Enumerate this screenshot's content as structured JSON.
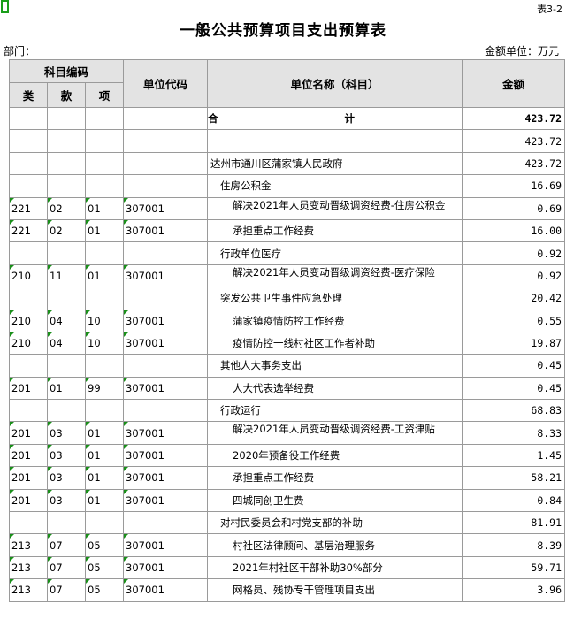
{
  "header": {
    "table_code": "表3-2",
    "title": "一般公共预算项目支出预算表",
    "dept_label": "部门：",
    "unit_label": "金额单位：万元"
  },
  "columns": {
    "subject_code": "科目编码",
    "lei": "类",
    "kuan": "款",
    "xiang": "项",
    "unit_code": "单位代码",
    "unit_name": "单位名称（科目）",
    "amount": "金额"
  },
  "rows": [
    {
      "lei": "",
      "kuan": "",
      "xiang": "",
      "code": "",
      "name": "合　　计",
      "amount": "423.72",
      "level": "total",
      "tri": false
    },
    {
      "lei": "",
      "kuan": "",
      "xiang": "",
      "code": "",
      "name": "",
      "amount": "423.72",
      "level": 0,
      "tri": false
    },
    {
      "lei": "",
      "kuan": "",
      "xiang": "",
      "code": "",
      "name": "达州市通川区蒲家镇人民政府",
      "amount": "423.72",
      "level": 0,
      "tri": false
    },
    {
      "lei": "",
      "kuan": "",
      "xiang": "",
      "code": "",
      "name": "住房公积金",
      "amount": "16.69",
      "level": 1,
      "tri": false
    },
    {
      "lei": "221",
      "kuan": "02",
      "xiang": "01",
      "code": "307001",
      "name": "解决2021年人员变动晋级调资经费-住房公积金",
      "amount": "0.69",
      "level": 2,
      "tri": true
    },
    {
      "lei": "221",
      "kuan": "02",
      "xiang": "01",
      "code": "307001",
      "name": "承担重点工作经费",
      "amount": "16.00",
      "level": 2,
      "tri": true
    },
    {
      "lei": "",
      "kuan": "",
      "xiang": "",
      "code": "",
      "name": "行政单位医疗",
      "amount": "0.92",
      "level": 1,
      "tri": false
    },
    {
      "lei": "210",
      "kuan": "11",
      "xiang": "01",
      "code": "307001",
      "name": "解决2021年人员变动晋级调资经费-医疗保险",
      "amount": "0.92",
      "level": 2,
      "tri": true
    },
    {
      "lei": "",
      "kuan": "",
      "xiang": "",
      "code": "",
      "name": "突发公共卫生事件应急处理",
      "amount": "20.42",
      "level": 1,
      "tri": false
    },
    {
      "lei": "210",
      "kuan": "04",
      "xiang": "10",
      "code": "307001",
      "name": "蒲家镇疫情防控工作经费",
      "amount": "0.55",
      "level": 2,
      "tri": true
    },
    {
      "lei": "210",
      "kuan": "04",
      "xiang": "10",
      "code": "307001",
      "name": "疫情防控一线村社区工作者补助",
      "amount": "19.87",
      "level": 2,
      "tri": true
    },
    {
      "lei": "",
      "kuan": "",
      "xiang": "",
      "code": "",
      "name": "其他人大事务支出",
      "amount": "0.45",
      "level": 1,
      "tri": false
    },
    {
      "lei": "201",
      "kuan": "01",
      "xiang": "99",
      "code": "307001",
      "name": "人大代表选举经费",
      "amount": "0.45",
      "level": 2,
      "tri": true
    },
    {
      "lei": "",
      "kuan": "",
      "xiang": "",
      "code": "",
      "name": "行政运行",
      "amount": "68.83",
      "level": 1,
      "tri": false
    },
    {
      "lei": "201",
      "kuan": "03",
      "xiang": "01",
      "code": "307001",
      "name": "解决2021年人员变动晋级调资经费-工资津贴",
      "amount": "8.33",
      "level": 2,
      "tri": true
    },
    {
      "lei": "201",
      "kuan": "03",
      "xiang": "01",
      "code": "307001",
      "name": "2020年预备役工作经费",
      "amount": "1.45",
      "level": 2,
      "tri": true
    },
    {
      "lei": "201",
      "kuan": "03",
      "xiang": "01",
      "code": "307001",
      "name": "承担重点工作经费",
      "amount": "58.21",
      "level": 2,
      "tri": true
    },
    {
      "lei": "201",
      "kuan": "03",
      "xiang": "01",
      "code": "307001",
      "name": "四城同创卫生费",
      "amount": "0.84",
      "level": 2,
      "tri": true
    },
    {
      "lei": "",
      "kuan": "",
      "xiang": "",
      "code": "",
      "name": "对村民委员会和村党支部的补助",
      "amount": "81.91",
      "level": 1,
      "tri": false
    },
    {
      "lei": "213",
      "kuan": "07",
      "xiang": "05",
      "code": "307001",
      "name": "村社区法律顾问、基层治理服务",
      "amount": "8.39",
      "level": 2,
      "tri": true
    },
    {
      "lei": "213",
      "kuan": "07",
      "xiang": "05",
      "code": "307001",
      "name": "2021年村社区干部补助30%部分",
      "amount": "59.71",
      "level": 2,
      "tri": true
    },
    {
      "lei": "213",
      "kuan": "07",
      "xiang": "05",
      "code": "307001",
      "name": "网格员、残协专干管理项目支出",
      "amount": "3.96",
      "level": 2,
      "tri": true
    }
  ]
}
